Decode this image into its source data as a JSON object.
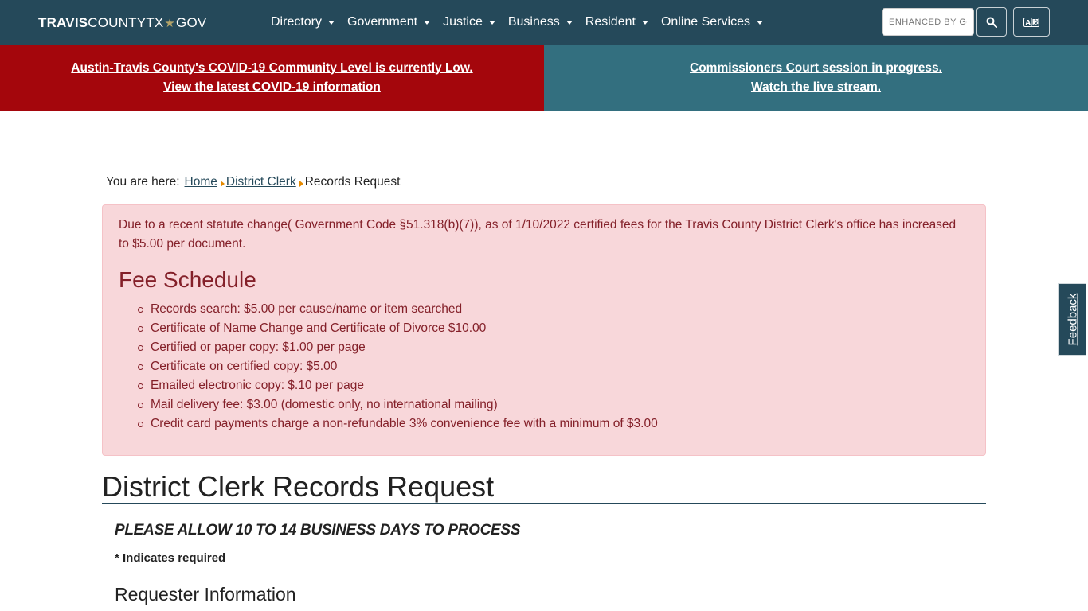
{
  "brand": {
    "part1": "TRAVIS",
    "part2": "COUNTYTX",
    "part3": "GOV"
  },
  "nav": {
    "items": [
      {
        "label": "Directory"
      },
      {
        "label": "Government"
      },
      {
        "label": "Justice"
      },
      {
        "label": "Business"
      },
      {
        "label": "Resident"
      },
      {
        "label": "Online Services"
      }
    ],
    "search_placeholder": "ENHANCED BY Google",
    "search_icon": "search-icon",
    "translate_icon": "translate-icon"
  },
  "banners": {
    "covid_line1": "Austin-Travis County's COVID-19 Community Level is currently Low.",
    "covid_line2": "View the latest COVID-19 information",
    "court_line1": "Commissioners Court session in progress.",
    "court_line2": "Watch the live stream.",
    "covid_color": "#a4060c",
    "court_color": "#336f7f"
  },
  "breadcrumb": {
    "label": "You are here:",
    "home": "Home",
    "parent": "District Clerk",
    "current": "Records Request"
  },
  "fee_alert": {
    "intro": "Due to a recent statute change( Government Code §51.318(b)(7)), as of 1/10/2022 certified fees for the Travis County District Clerk's office has increased to $5.00 per document.",
    "title": "Fee Schedule",
    "items": [
      "Records search: $5.00 per cause/name or item searched",
      "Certificate of Name Change and Certificate of Divorce $10.00",
      "Certified or paper copy: $1.00 per page",
      "Certificate on certified copy: $5.00",
      "Emailed electronic copy: $.10 per page",
      "Mail delivery fee: $3.00 (domestic only, no international mailing)",
      "Credit card payments charge a non-refundable 3% convenience fee with a minimum of $3.00"
    ]
  },
  "main": {
    "heading": "District Clerk Records Request",
    "process_note": "PLEASE ALLOW 10 TO 14 BUSINESS DAYS TO PROCESS",
    "required_note": "* Indicates required",
    "section_heading": "Requester Information"
  },
  "feedback": {
    "label": "Feedback"
  },
  "colors": {
    "navbar": "#25495a",
    "accent_arrow": "#e68a00",
    "alert_bg": "#f8d7da",
    "alert_text": "#842029"
  }
}
